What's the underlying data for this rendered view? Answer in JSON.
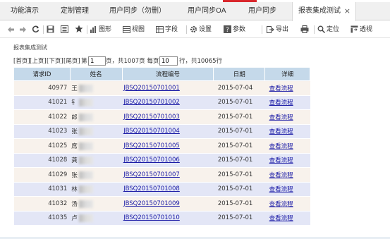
{
  "tabs": [
    {
      "label": "功能演示"
    },
    {
      "label": "定制管理"
    },
    {
      "label": "用户同步（勿删）"
    },
    {
      "label": "用户同步OA"
    },
    {
      "label": "用户同步"
    },
    {
      "label": "报表集成测试",
      "active": true
    }
  ],
  "tab_close": "×",
  "toolbar": {
    "first_icon": "arrow-left-icon",
    "prev_icon": "arrow-right-icon",
    "refresh_icon": "refresh-icon",
    "save_icon": "save-icon",
    "saveas_icon": "save-as-icon",
    "favorite_icon": "star-icon",
    "chart": "图形",
    "view": "视图",
    "field": "字段",
    "settings": "设置",
    "params": "参数",
    "export": "导出",
    "print_icon": "printer-icon",
    "locate": "定位",
    "pivot": "透视"
  },
  "report_title": "报表集成测试",
  "pager": {
    "first": "[首页]",
    "prev": "[上页]",
    "next": "[下页]",
    "last": "[尾页]",
    "page_prefix": "第",
    "page_value": "1",
    "page_suffix": "页，共1007页 每页",
    "per_page_value": "10",
    "total_suffix": "行，共10065行"
  },
  "table": {
    "headers": [
      "请求ID",
      "姓名",
      "流程编号",
      "日期",
      "详细"
    ],
    "rows": [
      {
        "id": "40977",
        "name": "王",
        "code": "JBSQ20150701001",
        "date": "2015-07-04",
        "detail": "查看流程"
      },
      {
        "id": "41021",
        "name": "钅",
        "code": "JBSQ20150701002",
        "date": "2015-07-01",
        "detail": "查看流程"
      },
      {
        "id": "41022",
        "name": "郎",
        "code": "JBSQ20150701003",
        "date": "2015-07-01",
        "detail": "查看流程"
      },
      {
        "id": "41023",
        "name": "张",
        "code": "JBSQ20150701004",
        "date": "2015-07-01",
        "detail": "查看流程"
      },
      {
        "id": "41025",
        "name": "席",
        "code": "JBSQ20150701005",
        "date": "2015-07-01",
        "detail": "查看流程"
      },
      {
        "id": "41028",
        "name": "龚",
        "code": "JBSQ20150701006",
        "date": "2015-07-01",
        "detail": "查看流程"
      },
      {
        "id": "41029",
        "name": "张",
        "code": "JBSQ20150701007",
        "date": "2015-07-01",
        "detail": "查看流程"
      },
      {
        "id": "41031",
        "name": "林",
        "code": "JBSQ20150701008",
        "date": "2015-07-01",
        "detail": "查看流程"
      },
      {
        "id": "41032",
        "name": "汤",
        "code": "JBSQ20150701009",
        "date": "2015-07-01",
        "detail": "查看流程"
      },
      {
        "id": "41035",
        "name": "卢",
        "code": "JBSQ20150701010",
        "date": "2015-07-01",
        "detail": "查看流程"
      }
    ]
  },
  "colors": {
    "header_bg": "#c5d9ea",
    "row_odd": "#f8f2ec",
    "row_even": "#e3e6f6",
    "link": "#1a1aa6",
    "accent": "#d9262b"
  }
}
